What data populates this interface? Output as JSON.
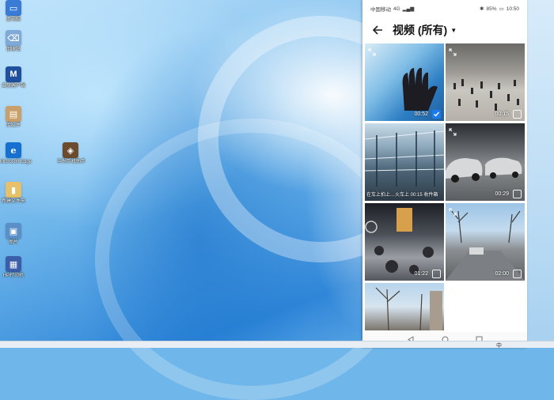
{
  "desktop": {
    "icons": [
      {
        "label": "此电脑",
        "color": "#3a7bd5",
        "glyph": "▭"
      },
      {
        "label": "回收站",
        "color": "#7fa9d9",
        "glyph": "🗑"
      },
      {
        "label": "云盘客户端",
        "color": "#1f4f9f",
        "glyph": "M"
      },
      {
        "label": "库文件",
        "color": "#c9a06a",
        "glyph": "▤"
      },
      {
        "label": "Microsoft Edge",
        "color": "#1570d0",
        "glyph": "e"
      },
      {
        "label": "新建文件夹",
        "color": "#e6c16a",
        "glyph": "▮"
      },
      {
        "label": "图片",
        "color": "#5a8fc7",
        "glyph": "▣"
      },
      {
        "label": "HP打印机",
        "color": "#3b5ea8",
        "glyph": "▦"
      },
      {
        "label": "华为手机助手",
        "color": "#6b4c2f",
        "glyph": "◈"
      }
    ],
    "tray_text": "中"
  },
  "phone": {
    "status": {
      "carrier": "中国移动",
      "network": "4G",
      "battery": "85%",
      "time": "10:50"
    },
    "title": "视频 (所有)",
    "videos": [
      {
        "duration": "00:52",
        "checked": true,
        "caption": "",
        "scene": "hand"
      },
      {
        "duration": "00:15",
        "checked": false,
        "caption": "",
        "scene": "crowd"
      },
      {
        "duration": "",
        "checked": false,
        "caption": "在车上拍上…火车上 00:15 收件箱",
        "scene": "station"
      },
      {
        "duration": "00:29",
        "checked": false,
        "caption": "",
        "scene": "parking"
      },
      {
        "duration": "01:22",
        "checked": false,
        "caption": "",
        "scene": "hall"
      },
      {
        "duration": "02:00",
        "checked": false,
        "caption": "",
        "scene": "street"
      },
      {
        "duration": "",
        "checked": false,
        "caption": "",
        "scene": "trees"
      }
    ]
  }
}
